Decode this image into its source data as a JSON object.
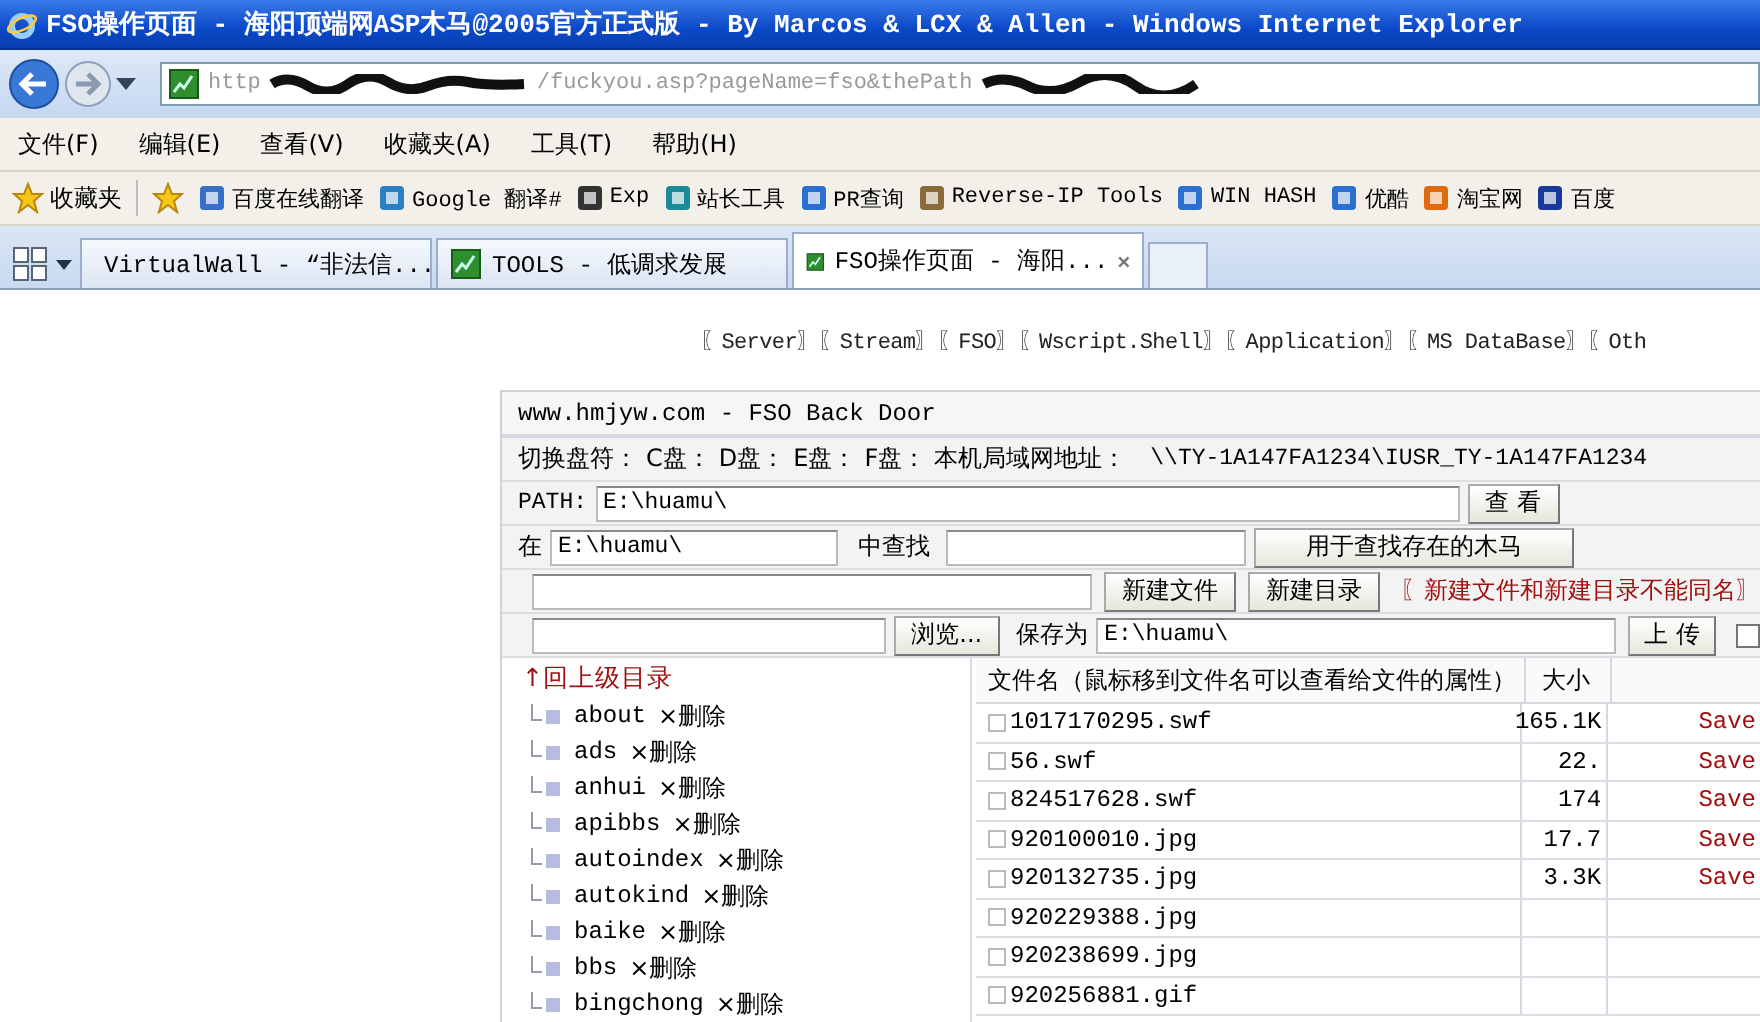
{
  "window": {
    "title": "FSO操作页面 - 海阳顶端网ASP木马@2005官方正式版 - By Marcos & LCX & Allen - Windows Internet Explorer"
  },
  "address_bar": {
    "url_start": "http",
    "url_end": "/fuckyou.asp?pageName=fso&thePath"
  },
  "menu": [
    "文件(F)",
    "编辑(E)",
    "查看(V)",
    "收藏夹(A)",
    "工具(T)",
    "帮助(H)"
  ],
  "favorites": {
    "label": "收藏夹",
    "links": [
      "百度在线翻译",
      "Google 翻译#",
      "Exp",
      "站长工具",
      "PR查询",
      "Reverse-IP Tools",
      "WIN HASH",
      "优酷",
      "淘宝网",
      "百度"
    ]
  },
  "tabs": [
    {
      "label": "VirtualWall - “非法信...",
      "selected": false
    },
    {
      "label": "TOOLS - 低调求发展",
      "selected": false
    },
    {
      "label": "FSO操作页面 - 海阳...",
      "selected": true
    }
  ],
  "nav": [
    "〖Server〗",
    "〖Stream〗",
    "〖FSO〗",
    "〖Wscript.Shell〗",
    "〖Application〗",
    "〖MS DataBase〗",
    "〖Oth"
  ],
  "panel": {
    "title": "www.hmjyw.com - FSO Back Door",
    "drive_label": "切换盘符：",
    "drives": [
      "C盘：",
      "D盘：",
      "E盘：",
      "F盘："
    ],
    "lan_label": "本机局域网地址：",
    "lan_value": "\\\\TY-1A147FA1234\\IUSR_TY-1A147FA1234",
    "path": {
      "label": "PATH:",
      "value": "E:\\huamu\\",
      "button": "查 看"
    },
    "search": {
      "label_before": "在",
      "value": "E:\\huamu\\",
      "label_after": "中查找",
      "button": "用于查找存在的木马"
    },
    "create": {
      "buttons": [
        "新建文件",
        "新建目录"
      ],
      "note": "〖新建文件和新建目录不能同名〗"
    },
    "upload": {
      "browse_button": "浏览...",
      "save_label": "保存为",
      "value": "E:\\huamu\\",
      "button": "上 传",
      "checked": false
    },
    "tree": {
      "up_link": "↑回上级目录",
      "folders": [
        {
          "name": "about",
          "delete": "×删除"
        },
        {
          "name": "ads",
          "delete": "×删除"
        },
        {
          "name": "anhui",
          "delete": "×删除"
        },
        {
          "name": "apibbs",
          "delete": "×删除"
        },
        {
          "name": "autoindex",
          "delete": "×删除"
        },
        {
          "name": "autokind",
          "delete": "×删除"
        },
        {
          "name": "baike",
          "delete": "×删除"
        },
        {
          "name": "bbs",
          "delete": "×删除"
        },
        {
          "name": "bingchong",
          "delete": "×删除"
        }
      ]
    },
    "table": {
      "columns": [
        "文件名（鼠标移到文件名可以查看给文件的属性）",
        "大小"
      ],
      "rows": [
        {
          "name": "1017170295.swf",
          "size": "165.1K",
          "action": "Save"
        },
        {
          "name": "56.swf",
          "size": "22.",
          "action": "Save"
        },
        {
          "name": "824517628.swf",
          "size": "174",
          "action": "Save"
        },
        {
          "name": "920100010.jpg",
          "size": "17.7",
          "action": "Save"
        },
        {
          "name": "920132735.jpg",
          "size": "3.3K",
          "action": "Save"
        },
        {
          "name": "920229388.jpg"
        },
        {
          "name": "920238699.jpg"
        },
        {
          "name": "920256881.gif"
        }
      ]
    }
  }
}
